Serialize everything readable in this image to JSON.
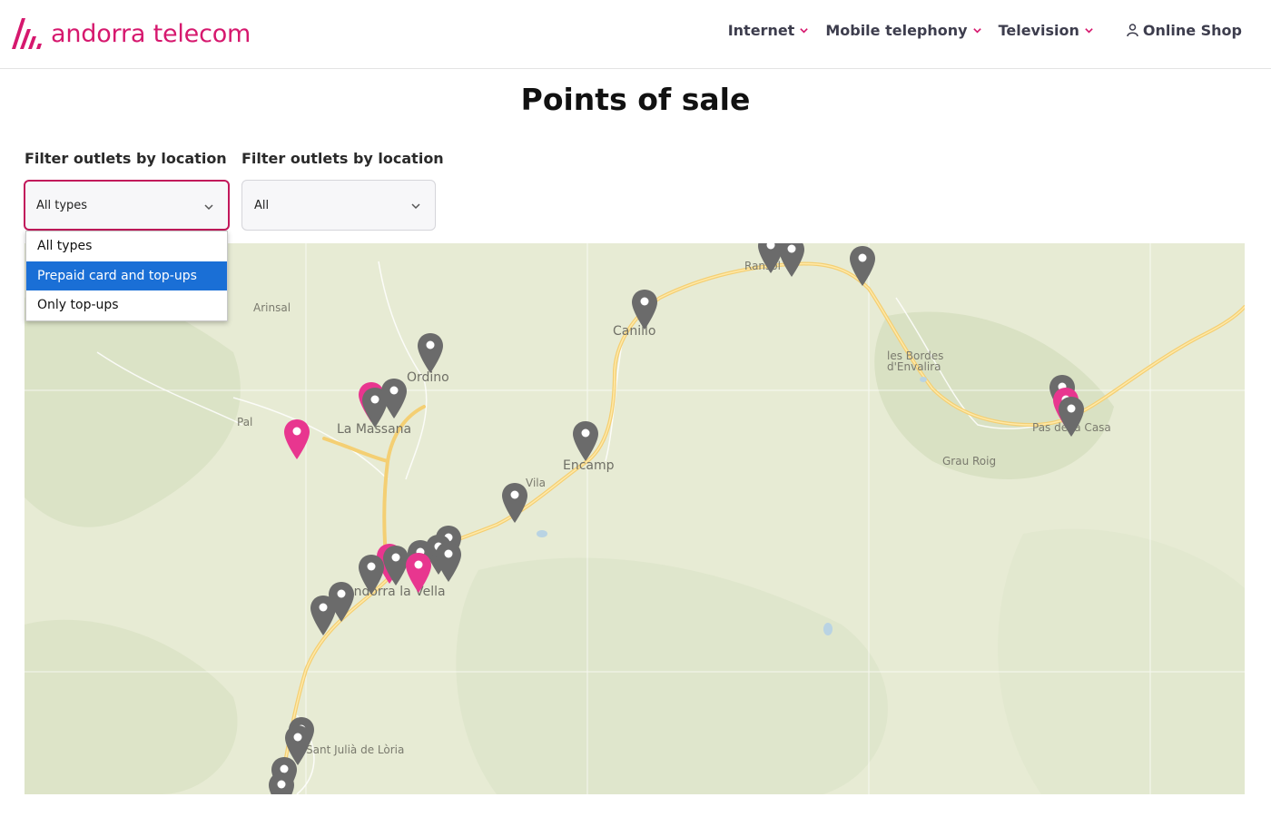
{
  "brand": {
    "name": "andorra telecom",
    "color": "#d6186e"
  },
  "nav": {
    "items": [
      {
        "label": "Internet"
      },
      {
        "label": "Mobile telephony"
      },
      {
        "label": "Television"
      }
    ],
    "shop_label": "Online Shop"
  },
  "page": {
    "title": "Points of sale"
  },
  "filters": {
    "type": {
      "label": "Filter outlets by location",
      "value": "All types",
      "options": [
        "All types",
        "Prepaid card and top-ups",
        "Only top-ups"
      ],
      "highlighted": "Prepaid card and top-ups"
    },
    "location": {
      "label": "Filter outlets by location",
      "value": "All"
    }
  },
  "map": {
    "places": {
      "arinsal": "Arinsal",
      "pal": "Pal",
      "ordino": "Ordino",
      "la_massana": "La Massana",
      "canillo": "Canillo",
      "ransol": "Ransol",
      "encamp": "Encamp",
      "vila": "Vila",
      "les_bordes": "les Bordes",
      "envalira": "d'Envalira",
      "grau_roig": "Grau Roig",
      "pas_de_la_casa": "Pas de la Casa",
      "andorra_la_vella": "Andorra la Vella",
      "sant_julia": "Sant Julià de Lòria"
    },
    "colors": {
      "pin_gray": "#6b6b6b",
      "pin_pink": "#e8368f",
      "road": "#f7d37a",
      "terrain": "#e6ead3"
    }
  }
}
